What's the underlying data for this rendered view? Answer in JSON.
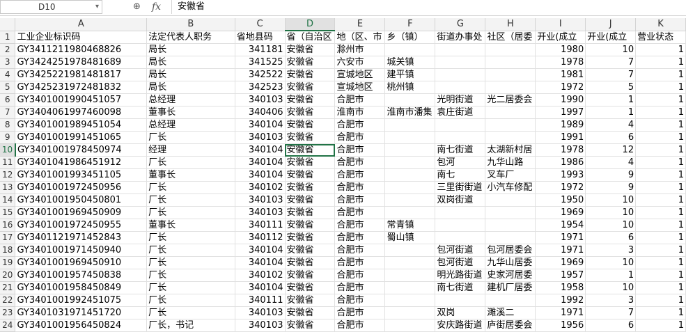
{
  "formula_bar": {
    "name_box": "D10",
    "zoom_icon": "zoom-icon",
    "fx_label": "fx",
    "value": "安徽省"
  },
  "columns": [
    "A",
    "B",
    "C",
    "D",
    "E",
    "F",
    "G",
    "H",
    "I",
    "J",
    "K"
  ],
  "selected_column": "D",
  "selected_row": "10",
  "rows": [
    {
      "n": "1",
      "A": "工业企业标识码",
      "B": "法定代表人职务",
      "C": "省地县码",
      "D": "省（自治区",
      "E": "地（区、市",
      "F": "乡（镇）",
      "G": "街道办事处",
      "H": "社区（居委",
      "I": "开业(成立",
      "J": "开业(成立",
      "K": "营业状态"
    },
    {
      "n": "2",
      "A": "GY3411211980468826",
      "B": "局长",
      "C": "341181",
      "D": "安徽省",
      "E": "滁州市",
      "F": "",
      "G": "",
      "H": "",
      "I": "1980",
      "J": "10",
      "K": "1"
    },
    {
      "n": "3",
      "A": "GY3424251978481689",
      "B": "局长",
      "C": "341525",
      "D": "安徽省",
      "E": "六安市",
      "F": "城关镇",
      "G": "",
      "H": "",
      "I": "1978",
      "J": "7",
      "K": "1"
    },
    {
      "n": "4",
      "A": "GY3425221981481817",
      "B": "局长",
      "C": "342522",
      "D": "安徽省",
      "E": "宣城地区",
      "F": "建平镇",
      "G": "",
      "H": "",
      "I": "1981",
      "J": "7",
      "K": "1"
    },
    {
      "n": "5",
      "A": "GY3425231972481832",
      "B": "局长",
      "C": "342523",
      "D": "安徽省",
      "E": "宣城地区",
      "F": "桃州镇",
      "G": "",
      "H": "",
      "I": "1972",
      "J": "5",
      "K": "1"
    },
    {
      "n": "6",
      "A": "GY3401001990451057",
      "B": "总经理",
      "C": "340103",
      "D": "安徽省",
      "E": "合肥市",
      "F": "",
      "G": "光明街道",
      "H": "光二居委会",
      "I": "1990",
      "J": "1",
      "K": "1"
    },
    {
      "n": "7",
      "A": "GY3404061997460098",
      "B": "董事长",
      "C": "340406",
      "D": "安徽省",
      "E": "淮南市",
      "F": "淮南市潘集",
      "G": "袁庄街道",
      "H": "",
      "I": "1997",
      "J": "1",
      "K": "1"
    },
    {
      "n": "8",
      "A": "GY3401001989451054",
      "B": "总经理",
      "C": "340104",
      "D": "安徽省",
      "E": "合肥市",
      "F": "",
      "G": "",
      "H": "",
      "I": "1989",
      "J": "4",
      "K": "1"
    },
    {
      "n": "9",
      "A": "GY3401001991451065",
      "B": "厂长",
      "C": "340103",
      "D": "安徽省",
      "E": "合肥市",
      "F": "",
      "G": "",
      "H": "",
      "I": "1991",
      "J": "6",
      "K": "1"
    },
    {
      "n": "10",
      "A": "GY3401001978450974",
      "B": "经理",
      "C": "340104",
      "D": "安徽省",
      "E": "合肥市",
      "F": "",
      "G": "南七街道",
      "H": "太湖新村居",
      "I": "1978",
      "J": "12",
      "K": "1"
    },
    {
      "n": "11",
      "A": "GY3401041986451912",
      "B": "厂长",
      "C": "340104",
      "D": "安徽省",
      "E": "合肥市",
      "F": "",
      "G": "包河",
      "H": "九华山路",
      "I": "1986",
      "J": "4",
      "K": "1"
    },
    {
      "n": "12",
      "A": "GY3401001993451105",
      "B": "董事长",
      "C": "340104",
      "D": "安徽省",
      "E": "合肥市",
      "F": "",
      "G": "南七",
      "H": "叉车厂",
      "I": "1993",
      "J": "9",
      "K": "1"
    },
    {
      "n": "13",
      "A": "GY3401001972450956",
      "B": "厂长",
      "C": "340102",
      "D": "安徽省",
      "E": "合肥市",
      "F": "",
      "G": "三里街街道",
      "H": "小汽车修配",
      "I": "1972",
      "J": "9",
      "K": "1"
    },
    {
      "n": "14",
      "A": "GY3401001950450801",
      "B": "厂长",
      "C": "340103",
      "D": "安徽省",
      "E": "合肥市",
      "F": "",
      "G": "双岗街道",
      "H": "",
      "I": "1950",
      "J": "10",
      "K": "1"
    },
    {
      "n": "15",
      "A": "GY3401001969450909",
      "B": "厂长",
      "C": "340103",
      "D": "安徽省",
      "E": "合肥市",
      "F": "",
      "G": "",
      "H": "",
      "I": "1969",
      "J": "10",
      "K": "1"
    },
    {
      "n": "16",
      "A": "GY3401001972450955",
      "B": "董事长",
      "C": "340111",
      "D": "安徽省",
      "E": "合肥市",
      "F": "常青镇",
      "G": "",
      "H": "",
      "I": "1954",
      "J": "10",
      "K": "1"
    },
    {
      "n": "17",
      "A": "GY3401121971452843",
      "B": "厂长",
      "C": "340112",
      "D": "安徽省",
      "E": "合肥市",
      "F": "蜀山镇",
      "G": "",
      "H": "",
      "I": "1971",
      "J": "6",
      "K": "1"
    },
    {
      "n": "18",
      "A": "GY3401001971450940",
      "B": "厂长",
      "C": "340104",
      "D": "安徽省",
      "E": "合肥市",
      "F": "",
      "G": "包河街道",
      "H": "包河居委会",
      "I": "1971",
      "J": "3",
      "K": "1"
    },
    {
      "n": "19",
      "A": "GY3401001969450910",
      "B": "厂长",
      "C": "340104",
      "D": "安徽省",
      "E": "合肥市",
      "F": "",
      "G": "包河街道",
      "H": "九华山居委",
      "I": "1969",
      "J": "10",
      "K": "1"
    },
    {
      "n": "20",
      "A": "GY3401001957450838",
      "B": "厂长",
      "C": "340102",
      "D": "安徽省",
      "E": "合肥市",
      "F": "",
      "G": "明光路街道",
      "H": "史家河居委",
      "I": "1957",
      "J": "1",
      "K": "1"
    },
    {
      "n": "21",
      "A": "GY3401001958450849",
      "B": "厂长",
      "C": "340104",
      "D": "安徽省",
      "E": "合肥市",
      "F": "",
      "G": "南七街道",
      "H": "建机厂居委",
      "I": "1958",
      "J": "10",
      "K": "1"
    },
    {
      "n": "22",
      "A": "GY3401001992451075",
      "B": "厂长",
      "C": "340111",
      "D": "安徽省",
      "E": "合肥市",
      "F": "",
      "G": "",
      "H": "",
      "I": "1992",
      "J": "3",
      "K": "1"
    },
    {
      "n": "23",
      "A": "GY3401031971451720",
      "B": "厂长",
      "C": "340103",
      "D": "安徽省",
      "E": "合肥市",
      "F": "",
      "G": "双岗",
      "H": "濉溪二",
      "I": "1971",
      "J": "7",
      "K": "1"
    },
    {
      "n": "24",
      "A": "GY3401001956450824",
      "B": "厂长，书记",
      "C": "340103",
      "D": "安徽省",
      "E": "合肥市",
      "F": "",
      "G": "安庆路街道",
      "H": "庐街居委会",
      "I": "1956",
      "J": "6",
      "K": "1"
    }
  ]
}
